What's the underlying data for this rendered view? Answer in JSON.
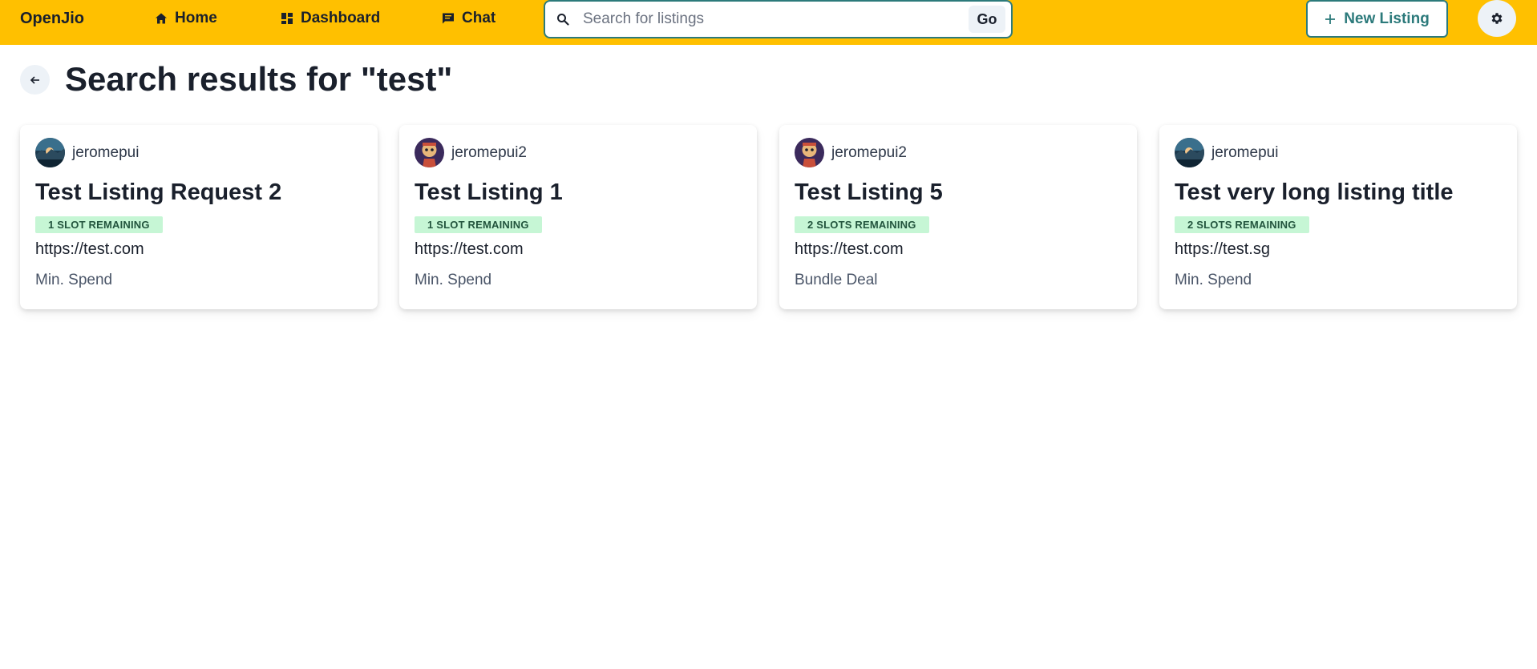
{
  "navbar": {
    "brand": "OpenJio",
    "links": [
      {
        "label": "Home",
        "icon": "home-icon"
      },
      {
        "label": "Dashboard",
        "icon": "dashboard-icon"
      },
      {
        "label": "Chat",
        "icon": "chat-icon"
      }
    ],
    "search": {
      "placeholder": "Search for listings",
      "value": "",
      "button_label": "Go"
    },
    "new_listing_label": "New Listing",
    "settings_icon": "gear-icon",
    "accent_color": "#ffc000",
    "primary_color": "#2c7a7b"
  },
  "header": {
    "title": "Search results for \"test\"",
    "back_icon": "arrow-left-icon"
  },
  "results": [
    {
      "username": "jeromepui",
      "avatar": "landscape-avatar",
      "title": "Test Listing Request 2",
      "slots": "1 SLOT REMAINING",
      "url": "https://test.com",
      "type": "Min. Spend"
    },
    {
      "username": "jeromepui2",
      "avatar": "cartoon-avatar",
      "title": "Test Listing 1",
      "slots": "1 SLOT REMAINING",
      "url": "https://test.com",
      "type": "Min. Spend"
    },
    {
      "username": "jeromepui2",
      "avatar": "cartoon-avatar",
      "title": "Test Listing 5",
      "slots": "2 SLOTS REMAINING",
      "url": "https://test.com",
      "type": "Bundle Deal"
    },
    {
      "username": "jeromepui",
      "avatar": "landscape-avatar",
      "title": "Test very long listing title",
      "slots": "2 SLOTS REMAINING",
      "url": "https://test.sg",
      "type": "Min. Spend"
    }
  ]
}
